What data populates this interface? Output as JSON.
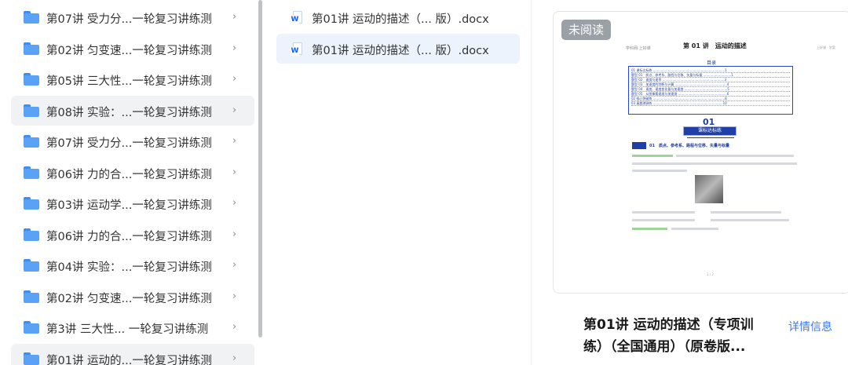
{
  "folders": [
    {
      "label": "第07讲 受力分...一轮复习讲练测",
      "selected": false
    },
    {
      "label": "第02讲 匀变速...一轮复习讲练测",
      "selected": false
    },
    {
      "label": "第05讲 三大性...一轮复习讲练测",
      "selected": false
    },
    {
      "label": "第08讲 实验：...一轮复习讲练测",
      "selected": true
    },
    {
      "label": "第07讲 受力分...一轮复习讲练测",
      "selected": false
    },
    {
      "label": "第06讲 力的合...一轮复习讲练测",
      "selected": false
    },
    {
      "label": "第03讲 运动学...一轮复习讲练测",
      "selected": false
    },
    {
      "label": "第06讲 力的合...一轮复习讲练测",
      "selected": false
    },
    {
      "label": "第04讲 实验：...一轮复习讲练测",
      "selected": false
    },
    {
      "label": "第02讲 匀变速...一轮复习讲练测",
      "selected": false
    },
    {
      "label": "第3讲 三大性... 一轮复习讲练测",
      "selected": false
    },
    {
      "label": "第01讲 运动的...一轮复习讲练测",
      "selected": true
    }
  ],
  "folder_chevron": "›",
  "files": [
    {
      "label": "第01讲 运动的描述（... 版）.docx",
      "selected": false
    },
    {
      "label": "第01讲 运动的描述（... 版）.docx",
      "selected": true
    }
  ],
  "file_icon_letter": "W",
  "preview": {
    "badge": "未阅读",
    "thumb_title": "第 01 讲　运动的描述",
    "thumb_header_left": "学科网·上好课",
    "thumb_header_mid": "www.zxxk.com",
    "thumb_header_right": "上好课 · 学案",
    "toc_label": "目录",
    "toc_lines": [
      "01 课标达标练 ........................................................................1",
      "题型 01　质点、参考系、路程与位移、矢量与标量 ............................1",
      "题型 02　速度与速率 ..............................................................3",
      "题型 03　加速度的判断与计算 ....................................................4",
      "题型 04　速度、速度变化量与加速度 ...........................................5",
      "题型 05　从图像看速度与加速度 .................................................6",
      "02 核心突破练 ........................................................................8",
      "03 真题溯源练 ......................................................................10"
    ],
    "big_num": "01",
    "section_bar": "课标达标练",
    "section_text": "01　质点、参考系、路程与位移、矢量与标量",
    "page_no": "1 / 2"
  },
  "document": {
    "title": "第01讲 运动的描述（专项训练）（全国通用）（原卷版...",
    "detail_link": "详情信息"
  },
  "colors": {
    "accent": "#3b79f5",
    "folder": "#5aa2f6",
    "selected_bg": "#f1f2f4",
    "file_selected_bg": "#edf3fd",
    "badge_bg": "#9aa0a6"
  }
}
